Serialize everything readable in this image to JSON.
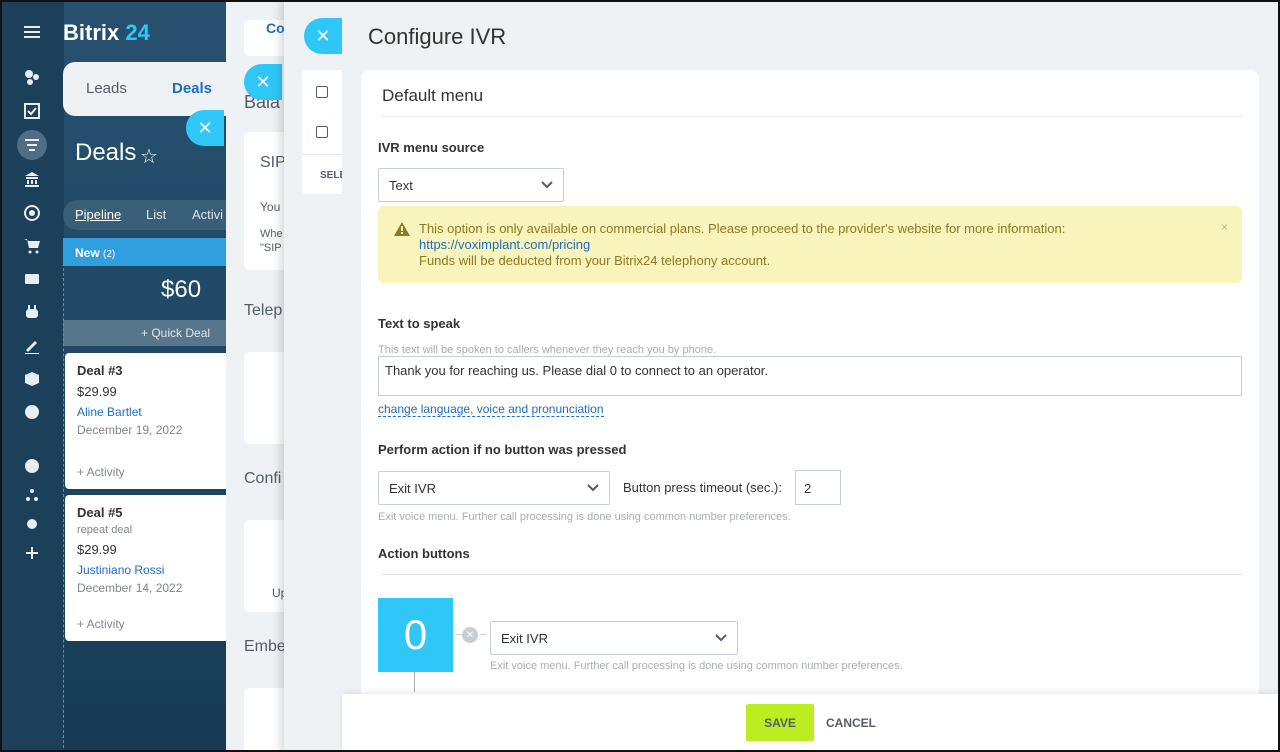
{
  "app": {
    "logo_main": "Bitrix",
    "logo_accent": "24"
  },
  "crm": {
    "tabs": [
      "Leads",
      "Deals"
    ],
    "title": "Deals",
    "views": [
      "Pipeline",
      "List",
      "Activi"
    ],
    "column": {
      "name": "New",
      "count": "(2)",
      "sum": "$60",
      "quick_deal": "Quick Deal"
    },
    "cards": [
      {
        "title": "Deal #3",
        "price": "$29.99",
        "contact": "Aline Bartlet",
        "date": "December 19, 2022",
        "activity": "+ Activity"
      },
      {
        "title": "Deal #5",
        "subtitle": "repeat deal",
        "price": "$29.99",
        "contact": "Justiniano Rossi",
        "date": "December 14, 2022",
        "activity": "+ Activity"
      }
    ]
  },
  "panel2": {
    "labels": [
      "Bala",
      "Telep",
      "Confi",
      "Embe"
    ],
    "sip": "SIP",
    "you": "You",
    "whe": "Whe",
    "sip2": "\"SIP",
    "up": "Up"
  },
  "panel3": {
    "tab": "Co",
    "sel": "SELE"
  },
  "slider": {
    "title": "Configure IVR",
    "section": "Default menu",
    "source_label": "IVR menu source",
    "source_value": "Text",
    "warning": {
      "line1": "This option is only available on commercial plans. Please proceed to the provider's website for more information:",
      "link": "https://voximplant.com/pricing",
      "line3": "Funds will be deducted from your Bitrix24 telephony account.",
      "close": "×"
    },
    "tts_label": "Text to speak",
    "tts_hint": "This text will be spoken to callers whenever they reach you by phone.",
    "tts_value": "Thank you for reaching us. Please dial 0 to connect to an operator.",
    "voice_link": "change language, voice and pronunciation",
    "noaction_label": "Perform action if no button was pressed",
    "noaction_value": "Exit IVR",
    "timeout_label": "Button press timeout (sec.):",
    "timeout_value": "2",
    "noaction_hint": "Exit voice menu. Further call processing is done using common number preferences.",
    "buttons_label": "Action buttons",
    "key": "0",
    "key_action": "Exit IVR",
    "key_hint": "Exit voice menu. Further call processing is done using common number preferences."
  },
  "footer": {
    "save": "SAVE",
    "cancel": "CANCEL"
  },
  "colors": {
    "accent": "#2fc7f7",
    "save": "#bbed21",
    "warning_bg": "#f8f4bc",
    "rail": "#1c3f5a"
  }
}
